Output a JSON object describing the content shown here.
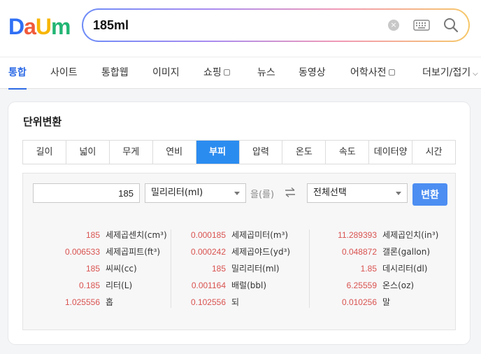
{
  "logo": {
    "letters": [
      {
        "char": "D",
        "color": "#2f6ff5"
      },
      {
        "char": "a",
        "color": "#f05a3a"
      },
      {
        "char": "U",
        "color": "#f7b500"
      },
      {
        "char": "m",
        "color": "#22b573"
      }
    ]
  },
  "search": {
    "value": "185ml",
    "clear_label": "×"
  },
  "tabs": [
    {
      "label": "통합",
      "active": true,
      "ext": false
    },
    {
      "label": "사이트",
      "active": false,
      "ext": false
    },
    {
      "label": "통합웹",
      "active": false,
      "ext": false
    },
    {
      "label": "이미지",
      "active": false,
      "ext": false
    },
    {
      "label": "쇼핑",
      "active": false,
      "ext": true
    },
    {
      "label": "뉴스",
      "active": false,
      "ext": false
    },
    {
      "label": "동영상",
      "active": false,
      "ext": false
    },
    {
      "label": "어학사전",
      "active": false,
      "ext": true
    },
    {
      "label": "더보기/접기",
      "active": false,
      "ext": false
    }
  ],
  "converter": {
    "title": "단위변환",
    "unit_tabs": [
      "길이",
      "넓이",
      "무게",
      "연비",
      "부피",
      "압력",
      "온도",
      "속도",
      "데이터양",
      "시간"
    ],
    "active_unit_tab": "부피",
    "input_value": "185",
    "from_unit": "밀리리터(ml)",
    "particle": "을(를)",
    "to_unit": "전체선택",
    "convert_label": "변환",
    "results": [
      [
        {
          "value": "185",
          "unit": "세제곱센치(cm³)"
        },
        {
          "value": "0.006533",
          "unit": "세제곱피트(ft³)"
        },
        {
          "value": "185",
          "unit": "씨씨(cc)"
        },
        {
          "value": "0.185",
          "unit": "리터(L)"
        },
        {
          "value": "1.025556",
          "unit": "홉"
        }
      ],
      [
        {
          "value": "0.000185",
          "unit": "세제곱미터(m³)"
        },
        {
          "value": "0.000242",
          "unit": "세제곱야드(yd³)"
        },
        {
          "value": "185",
          "unit": "밀리리터(ml)"
        },
        {
          "value": "0.001164",
          "unit": "배럴(bbl)"
        },
        {
          "value": "0.102556",
          "unit": "되"
        }
      ],
      [
        {
          "value": "11.289393",
          "unit": "세제곱인치(in³)"
        },
        {
          "value": "0.048872",
          "unit": "갤론(gallon)"
        },
        {
          "value": "1.85",
          "unit": "데시리터(dl)"
        },
        {
          "value": "6.25559",
          "unit": "온스(oz)"
        },
        {
          "value": "0.010256",
          "unit": "말"
        }
      ]
    ]
  },
  "colors": {
    "accent": "#2e6be6",
    "active_tab_bg": "#2b8cf0",
    "convert_button": "#4d8ef2",
    "result_number": "#d9534f"
  },
  "icons": [
    "clear-icon",
    "keyboard-icon",
    "search-icon",
    "swap-icon",
    "dropdown-arrow-icon",
    "external-link-icon",
    "chevron-down-icon"
  ]
}
